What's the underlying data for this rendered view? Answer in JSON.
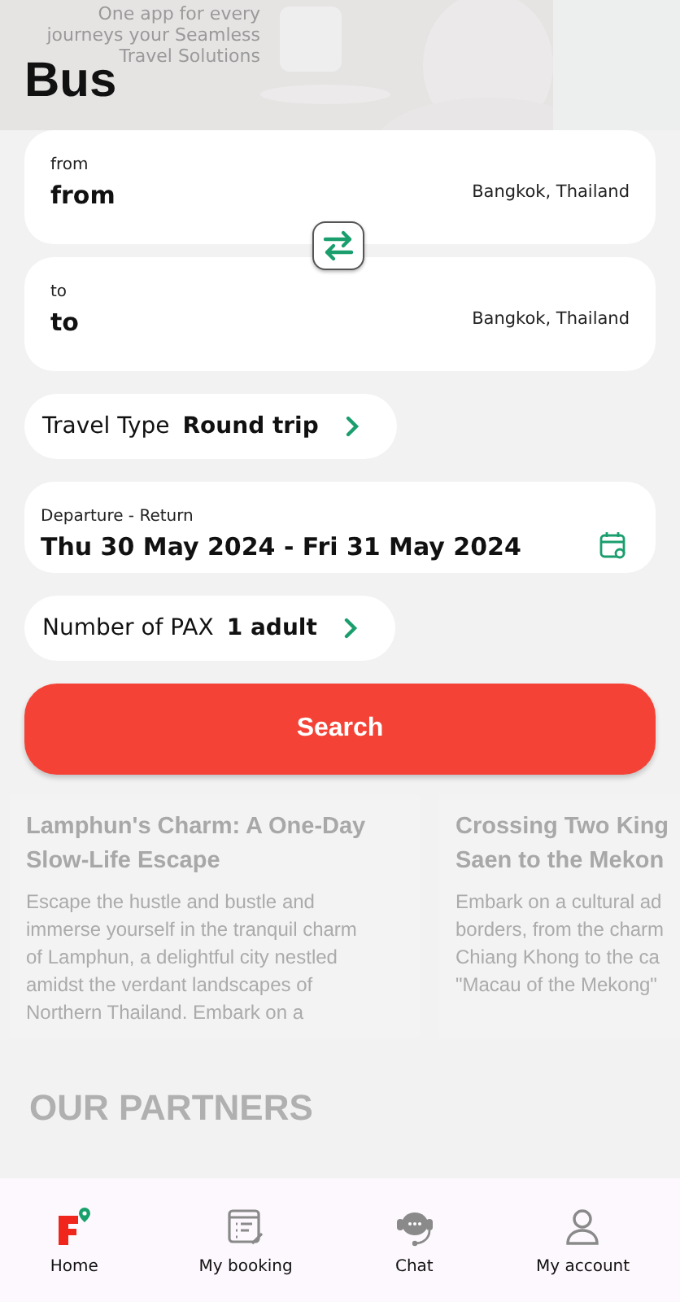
{
  "background": {
    "banner_lines": [
      "One app for every",
      "journeys your Seamless",
      "Travel Solutions"
    ],
    "articles": [
      {
        "title": [
          "Lamphun's Charm: A One-Day",
          "Slow-Life Escape"
        ],
        "body": [
          "Escape the hustle and bustle and",
          "immerse yourself in the tranquil charm",
          "of Lamphun, a delightful city nestled",
          "amidst the verdant landscapes of",
          "Northern Thailand. Embark on a"
        ]
      },
      {
        "title": [
          "Crossing Two King",
          "Saen to the Mekon"
        ],
        "body": [
          "Embark on a cultural ad",
          "borders, from the charm",
          "Chiang Khong to the ca",
          "\"Macau of the Mekong\""
        ]
      }
    ],
    "partners_heading": "OUR PARTNERS"
  },
  "title": "Bus",
  "from": {
    "label": "from",
    "value": "from",
    "place": "Bangkok, Thailand"
  },
  "to": {
    "label": "to",
    "value": "to",
    "place": "Bangkok, Thailand"
  },
  "travel_type": {
    "label": "Travel Type",
    "value": "Round trip"
  },
  "dates": {
    "label": "Departure - Return",
    "value": "Thu 30 May 2024 - Fri 31 May 2024"
  },
  "pax": {
    "label": "Number of PAX",
    "value": "1 adult"
  },
  "search_button": "Search",
  "nav": [
    {
      "kind": "home",
      "label": "Home",
      "selected": true
    },
    {
      "kind": "booking",
      "label": "My booking",
      "selected": false
    },
    {
      "kind": "chat",
      "label": "Chat",
      "selected": false
    },
    {
      "kind": "account",
      "label": "My account",
      "selected": false
    }
  ]
}
